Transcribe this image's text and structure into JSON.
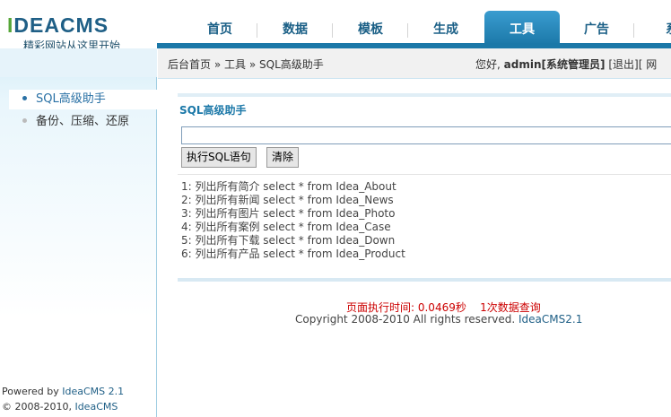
{
  "logo": {
    "brand_i": "I",
    "brand_rest": "DEACMS",
    "slogan": "精彩网站从这里开始"
  },
  "nav": [
    {
      "label": "首页"
    },
    {
      "label": "数据"
    },
    {
      "label": "模板"
    },
    {
      "label": "生成"
    },
    {
      "label": "工具",
      "active": true
    },
    {
      "label": "广告"
    },
    {
      "label": "系"
    }
  ],
  "breadcrumb": {
    "home": "后台首页",
    "sep1": "»",
    "section": "工具",
    "sep2": "»",
    "page": "SQL高级助手"
  },
  "user_bar": {
    "greeting": "您好,",
    "username": "admin[系统管理员]",
    "bracket_open": "[",
    "logout": "退出",
    "bracket_mid": "][",
    "tail": "网"
  },
  "sidebar": {
    "items": [
      {
        "label": "SQL高级助手",
        "active": true
      },
      {
        "label": "备份、压缩、还原",
        "active": false
      }
    ],
    "powered_prefix": "Powered by",
    "powered_link": "IdeaCMS 2.1",
    "copyright_prefix": "© 2008-2010,",
    "copyright_link": "IdeaCMS"
  },
  "main": {
    "title": "SQL高级助手",
    "input_value": "",
    "exec_button": "执行SQL语句",
    "clear_button": "清除",
    "examples": [
      "1: 列出所有简介 select * from Idea_About",
      "2: 列出所有新闻 select * from Idea_News",
      "3: 列出所有图片 select * from Idea_Photo",
      "4: 列出所有案例 select * from Idea_Case",
      "5: 列出所有下载 select * from Idea_Down",
      "6: 列出所有产品 select * from Idea_Product"
    ]
  },
  "footer": {
    "exec_time": "页面执行时间: 0.0469秒",
    "queries": "1次数据查询",
    "copyright": "Copyright 2008-2010 All rights reserved.",
    "version_link": "IdeaCMS2.1"
  },
  "colors": {
    "accent": "#1b78a8",
    "stat": "#cc0000",
    "brand_green": "#56a638"
  }
}
